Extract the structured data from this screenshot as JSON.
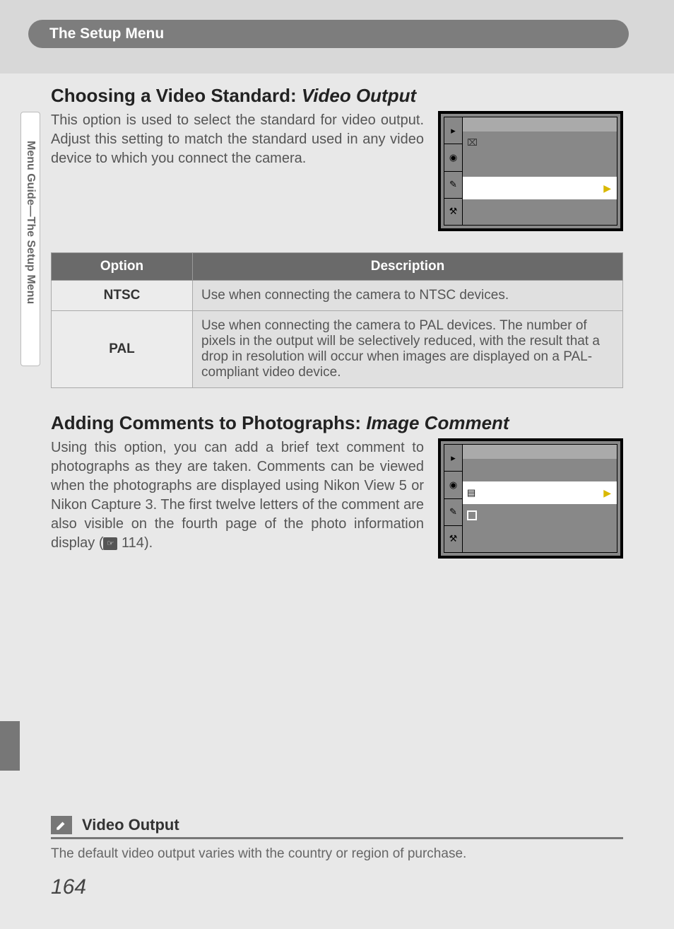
{
  "header": {
    "tab": "The Setup Menu"
  },
  "sidebar": {
    "label": "Menu Guide—The Setup Menu"
  },
  "section1": {
    "title_plain": "Choosing a Video Standard: ",
    "title_italic": "Video Output",
    "intro": "This option is used to select the standard for video output.  Adjust this setting to match the standard used in any video device to which you connect the camera."
  },
  "table": {
    "head_option": "Option",
    "head_desc": "Description",
    "rows": [
      {
        "option": "NTSC",
        "desc": "Use when connecting the camera to NTSC devices."
      },
      {
        "option": "PAL",
        "desc": "Use when connecting the camera to PAL devices.  The number of pixels in the output will be selectively reduced, with the result that a drop in resolution will occur when images are displayed on a PAL-compliant video device."
      }
    ]
  },
  "section2": {
    "title_plain": "Adding Comments to Photographs: ",
    "title_italic": "Image Comment",
    "intro_a": "Using this option, you can add a brief text comment to photographs as they are taken.  Comments can be viewed when the photographs are displayed using Nikon View 5 or Nikon Capture 3.  The first twelve letters of the comment are also visible on the fourth page of the photo information display (",
    "intro_ref": "114",
    "intro_b": ")."
  },
  "note": {
    "title": "Video Output",
    "body": "The default video output varies with the country or region of purchase."
  },
  "page_number": "164",
  "screens": {
    "s1": {
      "tabs": [
        "▸",
        "⌂",
        "✎",
        "⚙"
      ],
      "highlight_row": 2
    },
    "s2": {
      "tabs": [
        "▸",
        "⌂",
        "✎",
        "⚙"
      ],
      "highlight_row": 1
    }
  }
}
